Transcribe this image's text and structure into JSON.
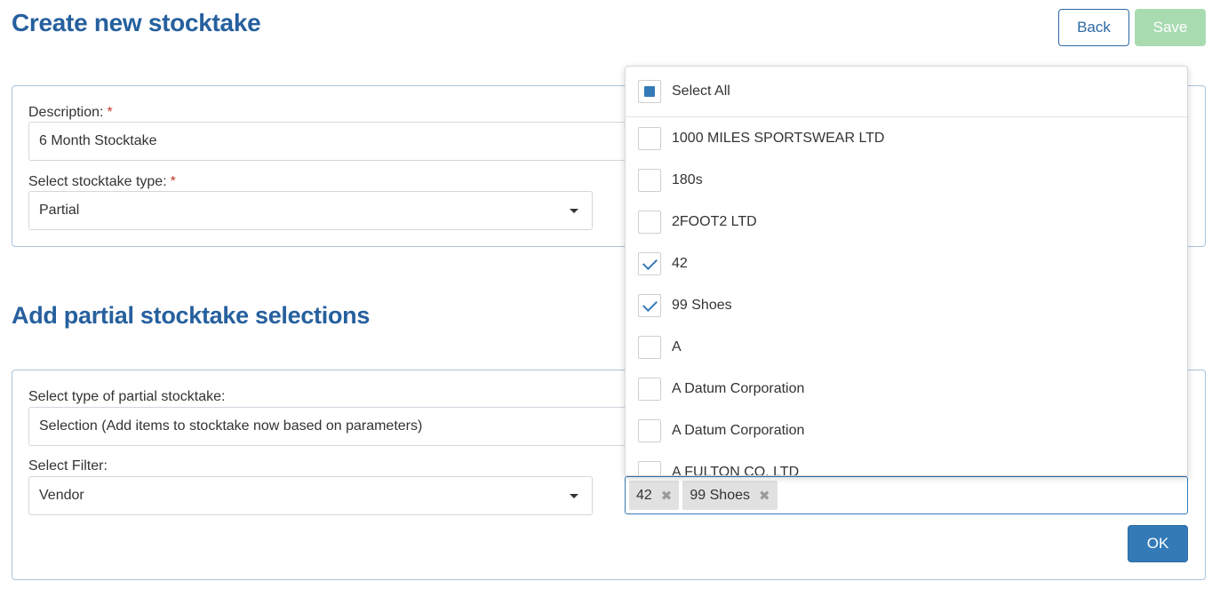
{
  "page": {
    "title": "Create new stocktake",
    "back_label": "Back",
    "save_label": "Save"
  },
  "details": {
    "description_label": "Description:",
    "description_value": "6 Month Stocktake",
    "type_label": "Select stocktake type:",
    "type_value": "Partial",
    "required_mark": "*"
  },
  "partial": {
    "section_title": "Add partial stocktake selections",
    "kind_label": "Select type of partial stocktake:",
    "kind_value": "Selection (Add items to stocktake now based on parameters)",
    "filter_label": "Select Filter:",
    "filter_value": "Vendor",
    "ok_label": "OK"
  },
  "vendor_select": {
    "select_all_label": "Select All",
    "select_all_state": "partial",
    "options": [
      {
        "label": "1000 MILES SPORTSWEAR LTD",
        "checked": false
      },
      {
        "label": "180s",
        "checked": false
      },
      {
        "label": "2FOOT2 LTD",
        "checked": false
      },
      {
        "label": "42",
        "checked": true
      },
      {
        "label": "99 Shoes",
        "checked": true
      },
      {
        "label": "A",
        "checked": false
      },
      {
        "label": "A Datum Corporation",
        "checked": false
      },
      {
        "label": "A Datum Corporation",
        "checked": false
      },
      {
        "label": "A FULTON CO. LTD",
        "checked": false
      }
    ],
    "selected_chips": [
      "42",
      "99 Shoes"
    ],
    "chip_remove_glyph": "✖"
  },
  "colors": {
    "heading": "#26609e",
    "primary": "#337ab7",
    "save_disabled": "#a9dbb1"
  }
}
